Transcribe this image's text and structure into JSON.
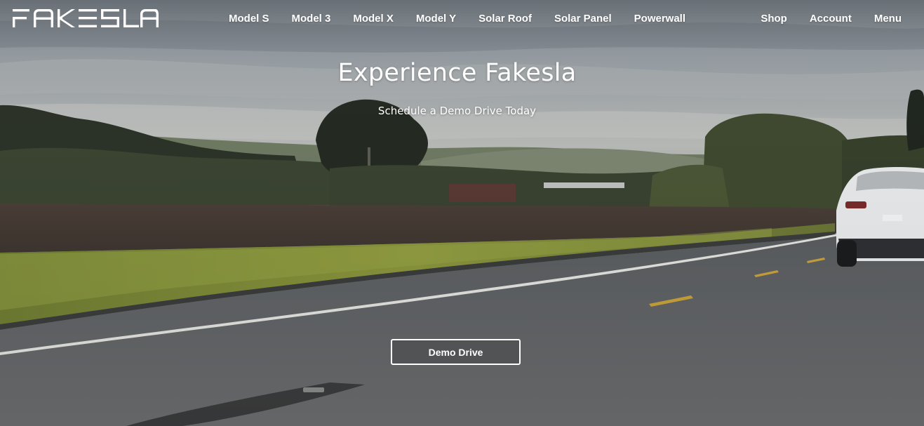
{
  "brand": {
    "logo_text": "FAKESLA"
  },
  "nav": {
    "center_items": [
      {
        "label": "Model S"
      },
      {
        "label": "Model 3"
      },
      {
        "label": "Model X"
      },
      {
        "label": "Model Y"
      },
      {
        "label": "Solar Roof"
      },
      {
        "label": "Solar Panel"
      },
      {
        "label": "Powerwall"
      }
    ],
    "right_items": [
      {
        "label": "Shop"
      },
      {
        "label": "Account"
      },
      {
        "label": "Menu"
      }
    ]
  },
  "hero": {
    "title": "Experience Fakesla",
    "subtitle": "Schedule a Demo Drive Today",
    "cta_label": "Demo Drive",
    "background_description_icon": "road-landscape-image"
  },
  "colors": {
    "text": "#ffffff",
    "button_border": "#ffffff",
    "sky": "#8d949b",
    "grass": "#7c8a3a",
    "road": "#5e6164",
    "lane_yellow": "#c9a23a",
    "car": "#e9ebee"
  }
}
